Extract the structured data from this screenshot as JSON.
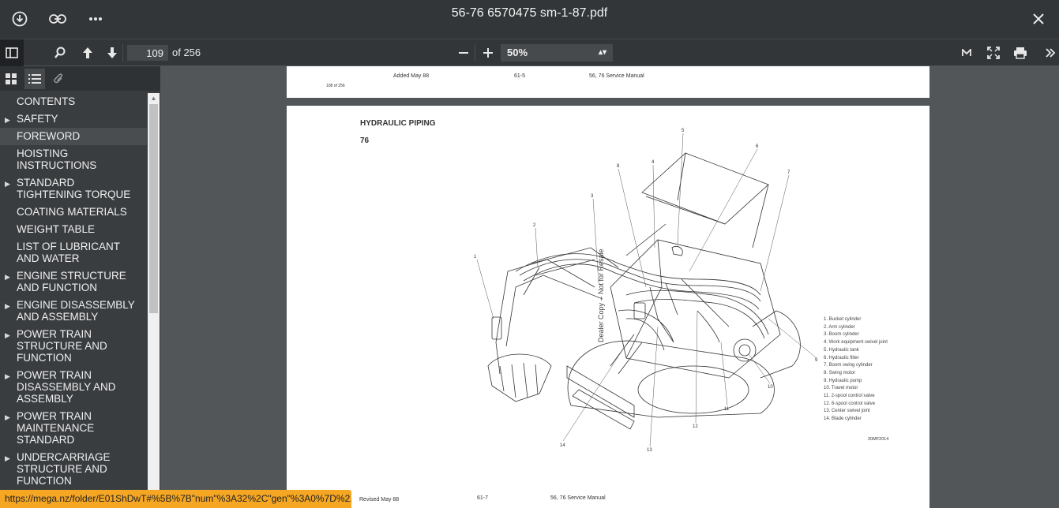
{
  "window": {
    "title": "56-76 6570475 sm-1-87.pdf"
  },
  "toolbar": {
    "page_current": "109",
    "page_total": "of 256",
    "zoom": "50%"
  },
  "sidebar": {
    "items": [
      {
        "label": "CONTENTS",
        "expandable": false
      },
      {
        "label": "SAFETY",
        "expandable": true
      },
      {
        "label": "FOREWORD",
        "expandable": false,
        "selected": true
      },
      {
        "label": "HOISTING INSTRUCTIONS",
        "expandable": false
      },
      {
        "label": "STANDARD TIGHTENING TORQUE",
        "expandable": true
      },
      {
        "label": "COATING MATERIALS",
        "expandable": false
      },
      {
        "label": "WEIGHT TABLE",
        "expandable": false
      },
      {
        "label": "LIST OF LUBRICANT AND WATER",
        "expandable": false
      },
      {
        "label": "ENGINE STRUCTURE AND FUNCTION",
        "expandable": true
      },
      {
        "label": "ENGINE DISASSEMBLY AND ASSEMBLY",
        "expandable": true
      },
      {
        "label": "POWER TRAIN STRUCTURE AND FUNCTION",
        "expandable": true
      },
      {
        "label": "POWER TRAIN DISASSEMBLY AND ASSEMBLY",
        "expandable": true
      },
      {
        "label": "POWER TRAIN MAINTENANCE STANDARD",
        "expandable": true
      },
      {
        "label": "UNDERCARRIAGE STRUCTURE AND FUNCTION",
        "expandable": true
      }
    ]
  },
  "prev_page": {
    "page_no": "108 of 256",
    "added": "Added May 88",
    "code": "61-5",
    "manual": "56, 76 Service Manual"
  },
  "current_page": {
    "title": "HYDRAULIC PIPING",
    "model": "76",
    "watermark": "Dealer Copy -- Not for Resale",
    "figure_no": "20MF2014",
    "revised": "Revised May 88",
    "code": "61-7",
    "manual": "56, 76 Service Manual",
    "legend": [
      "1.  Bucket cylinder",
      "2.  Arm cylinder",
      "3.  Boom cylinder",
      "4.  Work equipment swivel joint",
      "5.  Hydraulic tank",
      "6.  Hydraulic filter",
      "7.  Boom swing cylinder",
      "8.  Swing motor",
      "9.  Hydraulic pump",
      "10.  Travel motor",
      "11.  2-spool control valve",
      "12.  6-spool control valve",
      "13.  Center swivel joint",
      "14.  Blade cylinder"
    ],
    "callouts": [
      "1",
      "2",
      "3",
      "4",
      "5",
      "6",
      "7",
      "8",
      "9",
      "10",
      "11",
      "12",
      "13",
      "14"
    ]
  },
  "status": {
    "url": "https://mega.nz/folder/E01ShDwT#%5B%7B\"num\"%3A32%2C\"gen\"%3A0%7D%2..."
  }
}
